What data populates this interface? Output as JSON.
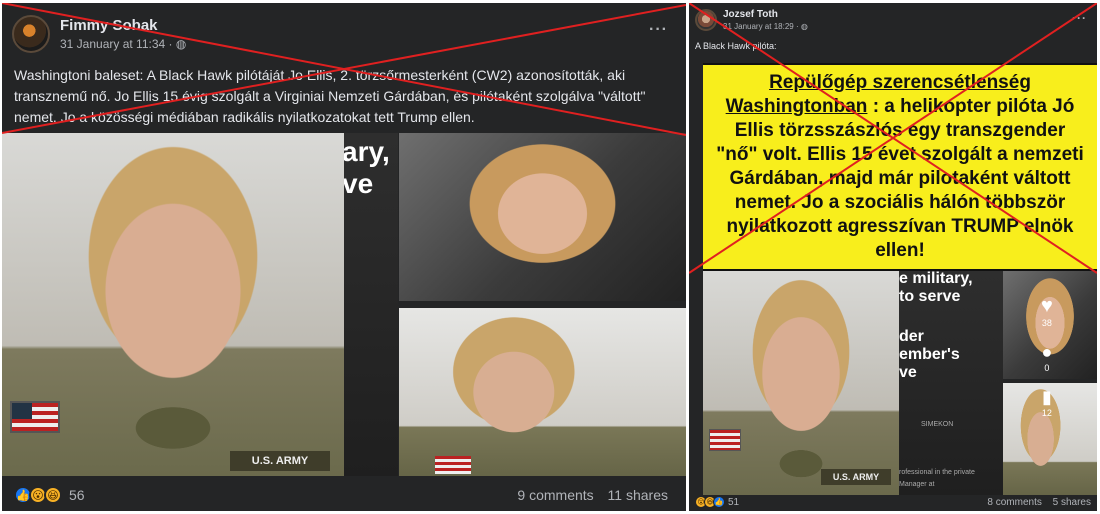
{
  "left_post": {
    "author": "Fimmy Sobak",
    "date": "31 January at 11:34",
    "privacy_icon": "globe-icon",
    "more": "···",
    "text": "Washingtoni baleset: A Black Hawk pilótáját Jo Ellis, 2. törzsőrmesterként (CW2) azonosították, aki transznemű nő. Jo Ellis 15 évig szolgált a Virginiai Nemzeti Gárdában, és pilótaként szolgálva \"váltott\" nemet. Jo a közösségi médiában radikális nyilatkozatokat tett Trump ellen.",
    "leak_text_a": "ary,",
    "leak_text_b": "ve",
    "reactions_count": "56",
    "comments": "9 comments",
    "shares": "11 shares"
  },
  "right_post": {
    "author": "Jozsef Toth",
    "date": "31 January at 18:29",
    "privacy_icon": "globe-icon",
    "more": "···",
    "intro": "A Black Hawk pilóta:",
    "banner_title": "Repülőgép szerencsétlenség",
    "banner_title2": "Washingtonban",
    "banner_body": " : a helikopter pilóta  Jó Ellis törzsszászlós egy transzgender \"nő\" volt. Ellis 15 évet szolgált a nemzeti Gárdában, majd már pilotaként váltott nemet. Jo a szociális hálón többször nyilatkozott agresszívan TRUMP elnök ellen!",
    "screen_text_1": "e military,",
    "screen_text_2": "to serve",
    "screen_text_3": "der",
    "screen_text_4": "ember's",
    "screen_text_5": "ve",
    "screen_small_1": "SIMEKON",
    "screen_small_2": "rofessional in the private",
    "screen_small_3": "Manager at",
    "side_likes": "38",
    "side_comments": "0",
    "side_shares": "12",
    "reactions_count": "51",
    "comments": "8 comments",
    "shares": "5 shares"
  },
  "patch_text": "U.S. ARMY",
  "patch_text_short": "S. ARMY",
  "colors": {
    "card_bg": "#242526",
    "cross_red": "#e02020",
    "banner_yellow": "#f8ee1c"
  }
}
